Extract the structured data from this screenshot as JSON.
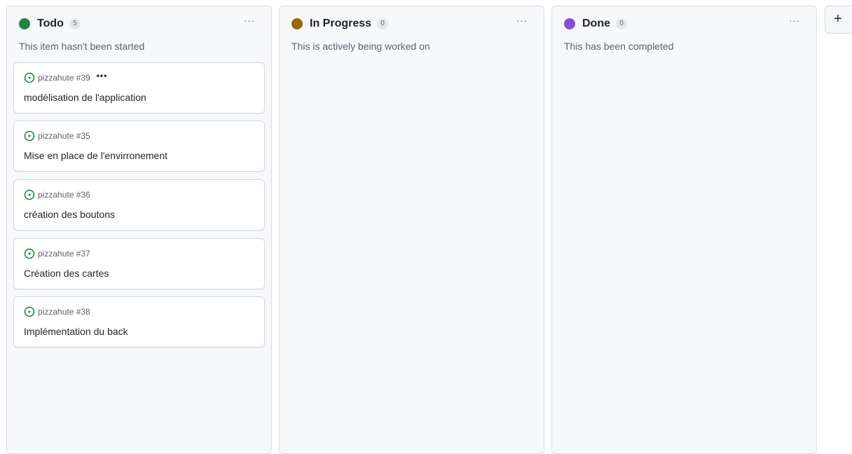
{
  "columns": [
    {
      "title": "Todo",
      "count": "5",
      "color": "#1f883d",
      "description": "This item hasn't been started",
      "menu": "···",
      "cards": [
        {
          "ref": "pizzahute #39",
          "title": "modélisation de l'application",
          "menu": "•••"
        },
        {
          "ref": "pizzahute #35",
          "title": "Mise en place de l'envirronement"
        },
        {
          "ref": "pizzahute #36",
          "title": "création des boutons"
        },
        {
          "ref": "pizzahute #37",
          "title": "Création des cartes"
        },
        {
          "ref": "pizzahute #38",
          "title": "Implémentation du back"
        }
      ]
    },
    {
      "title": "In Progress",
      "count": "0",
      "color": "#9a6700",
      "description": "This is actively being worked on",
      "menu": "···",
      "cards": []
    },
    {
      "title": "Done",
      "count": "0",
      "color": "#8250df",
      "description": "This has been completed",
      "menu": "···",
      "cards": []
    }
  ],
  "add_column": {
    "label": "+"
  },
  "icons": {
    "issue_open": "issue-open-icon",
    "issue_open_color": "#1a7f37"
  }
}
